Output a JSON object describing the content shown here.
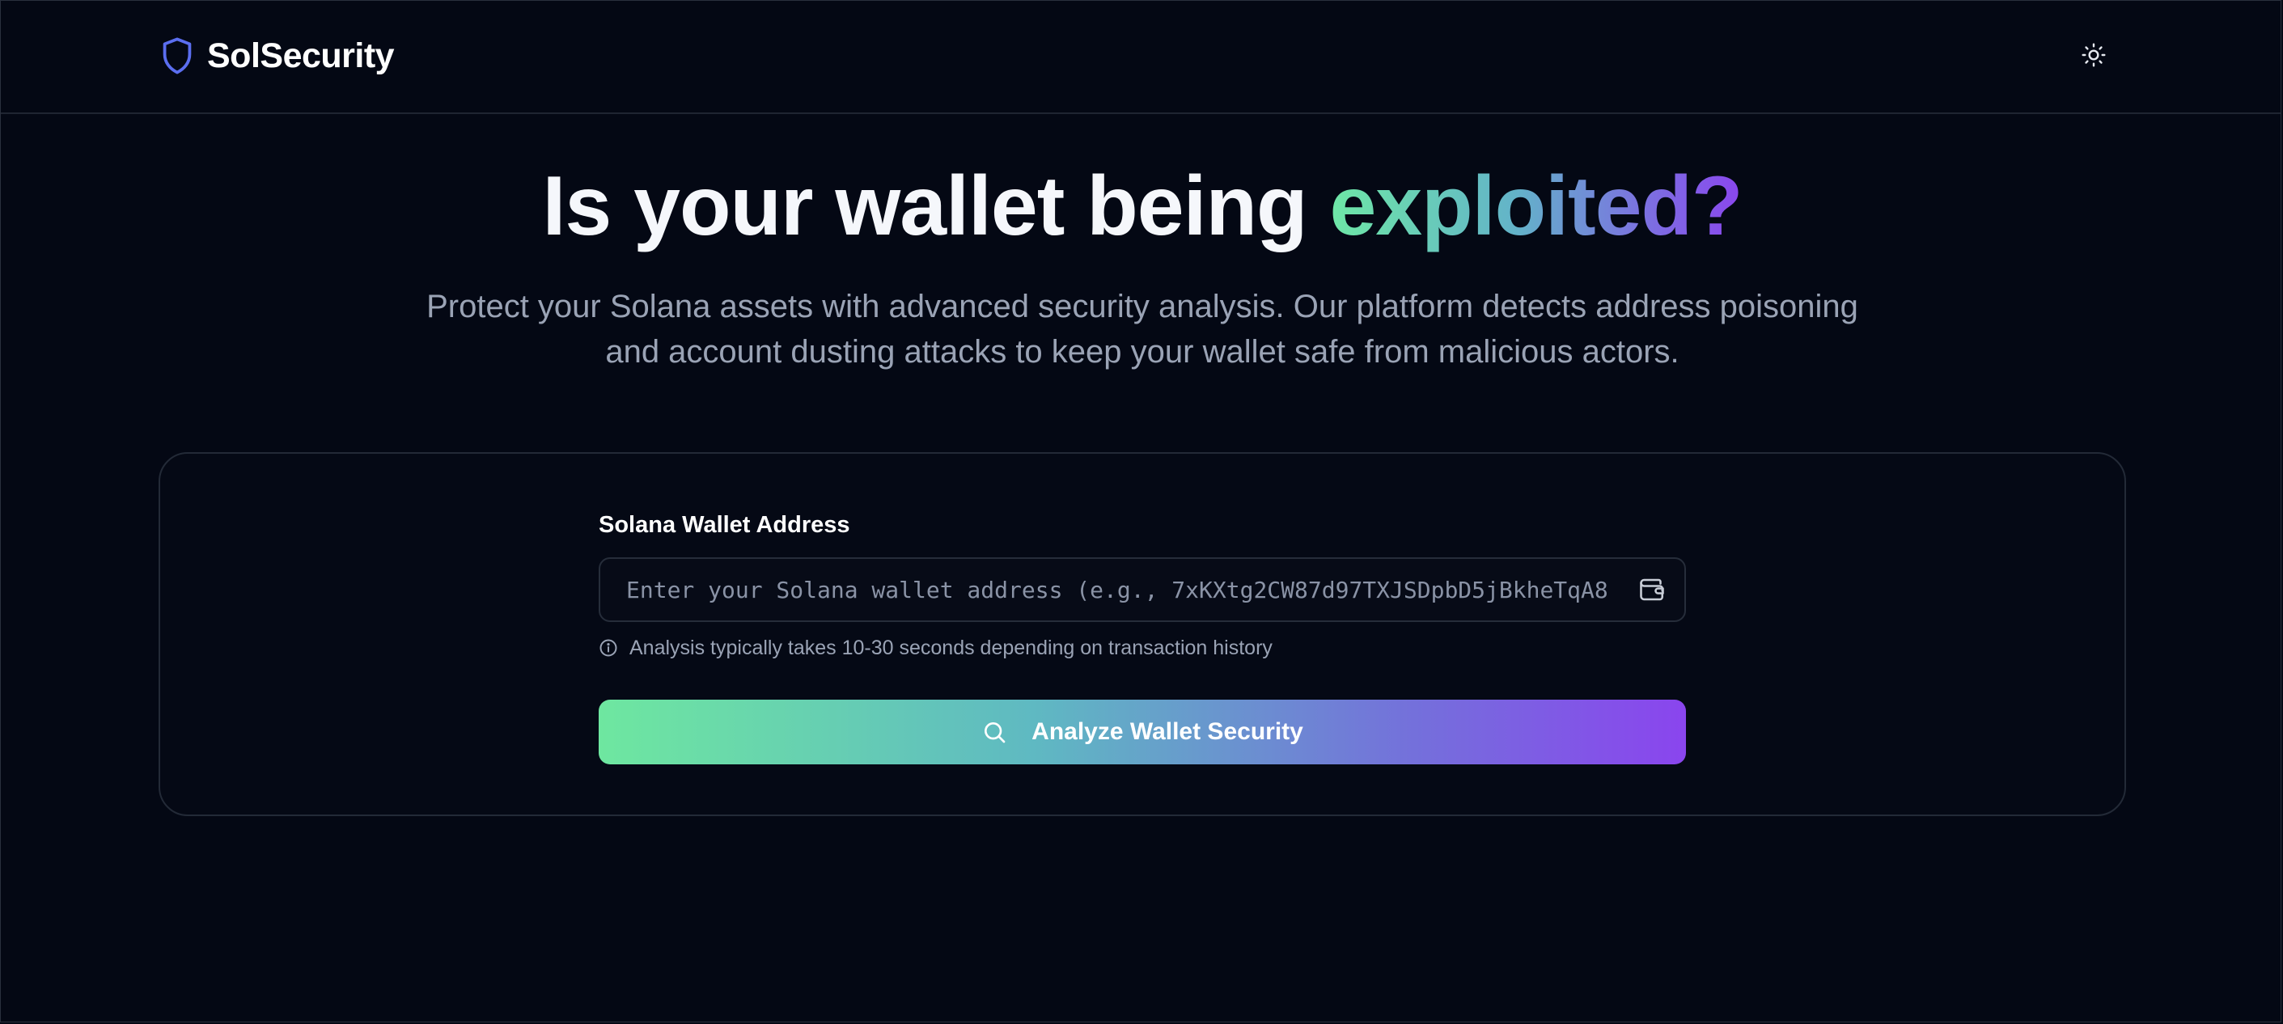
{
  "header": {
    "brand_name": "SolSecurity",
    "brand_icon": "shield-icon",
    "theme_toggle_icon": "sun-icon"
  },
  "hero": {
    "title_prefix": "Is your wallet being ",
    "title_highlight": "exploited?",
    "subtitle": "Protect your Solana assets with advanced security analysis. Our platform detects address poisoning and account dusting attacks to keep your wallet safe from malicious actors."
  },
  "form": {
    "label": "Solana Wallet Address",
    "input_value": "",
    "input_placeholder": "Enter your Solana wallet address (e.g., 7xKXtg2CW87d97TXJSDpbD5jBkheTqA8",
    "input_icon": "wallet-icon",
    "hint_icon": "info-icon",
    "hint": "Analysis typically takes 10-30 seconds depending on transaction history",
    "button_icon": "search-icon",
    "button_label": "Analyze Wallet Security"
  },
  "colors": {
    "background": "#040814",
    "accent_green": "#6ee7a6",
    "accent_purple": "#8a46ee",
    "brand_icon": "#5b6ef0",
    "muted_text": "#9aa3b5"
  }
}
